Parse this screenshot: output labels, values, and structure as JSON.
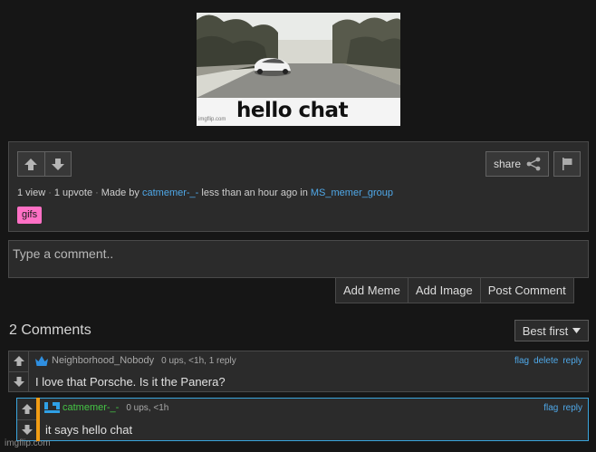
{
  "gif": {
    "caption": "hello chat",
    "watermark": "imgflip.com"
  },
  "post": {
    "share_label": "share",
    "meta": {
      "views": "1 view",
      "upvotes": "1 upvote",
      "made_by_prefix": "Made by",
      "author": "catmemer-_-",
      "time_text": "less than an hour ago in",
      "stream": "MS_memer_group"
    },
    "tag": "gifs"
  },
  "comment_form": {
    "placeholder": "Type a comment..",
    "add_meme": "Add Meme",
    "add_image": "Add Image",
    "post_comment": "Post Comment"
  },
  "comments_header": {
    "count_label": "2 Comments",
    "sort_label": "Best first"
  },
  "comments": [
    {
      "username": "Neighborhood_Nobody",
      "stats": "0 ups, <1h, 1 reply",
      "text": "I love that Porsche. Is it the Panera?",
      "actions": [
        "flag",
        "delete",
        "reply"
      ]
    },
    {
      "username": "catmemer-_-",
      "stats": "0 ups, <1h",
      "text": "it says hello chat",
      "actions": [
        "flag",
        "reply"
      ]
    }
  ],
  "footer": {
    "watermark": "imgflip.com"
  },
  "colors": {
    "background": "#161616",
    "panel": "#2b2b2b",
    "link": "#4fa8e8",
    "tag": "#ff70c5",
    "reply_border": "#3aa5dd",
    "reply_accent": "#f29c14",
    "reply_username": "#45c445"
  },
  "icons": [
    "upvote-arrow-icon",
    "downvote-arrow-icon",
    "share-icon",
    "flag-icon",
    "crown-icon",
    "pixel-avatar-icon",
    "caret-down-icon"
  ]
}
